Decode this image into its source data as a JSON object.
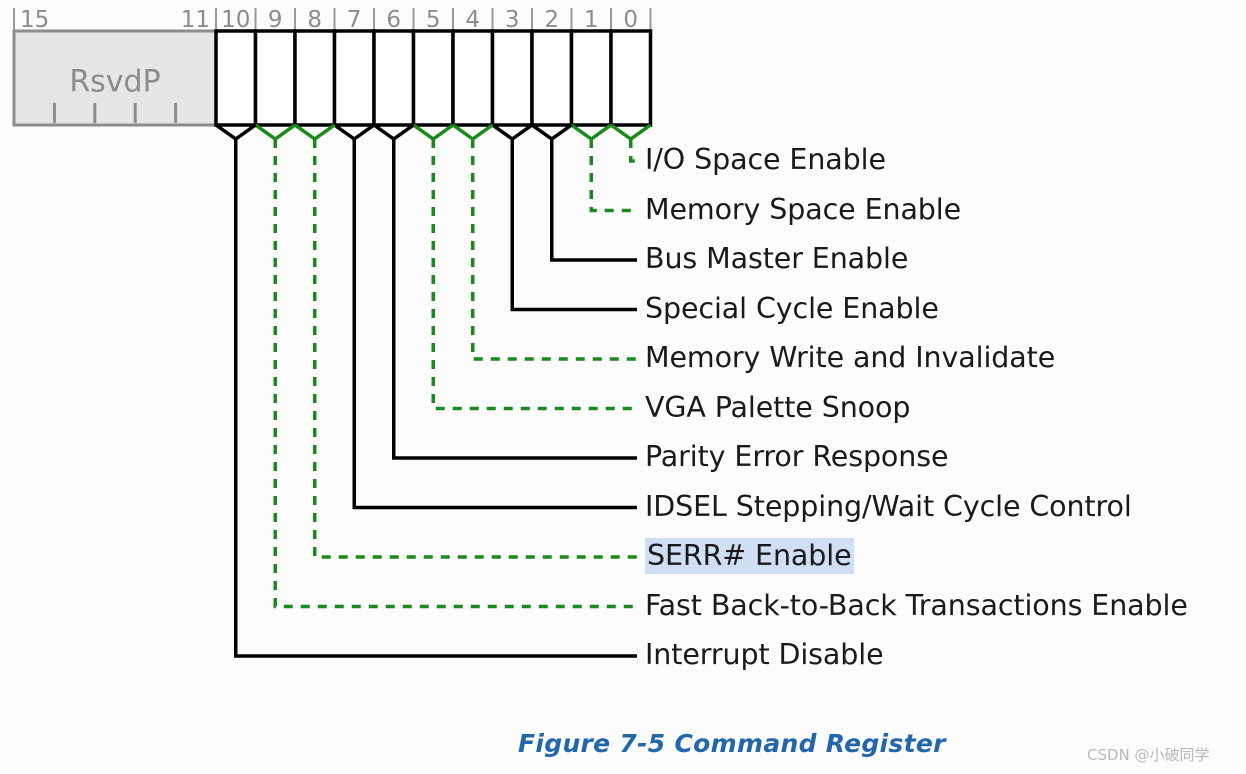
{
  "figure": {
    "caption": "Figure  7-5  Command Register",
    "watermark": "CSDN @小破同学",
    "background_color": "#fcfcfc"
  },
  "colors": {
    "green_leader": "#1a8a1a",
    "black_leader": "#000000",
    "bit_number": "#8c8c8c",
    "reserved_fill": "#e6e6e6",
    "reserved_border": "#8c8c8c",
    "highlight": "#cfe0f5",
    "caption": "#2266ac",
    "watermark": "#b9b9b9"
  },
  "register": {
    "name": "Command Register",
    "width_bits": 16,
    "reserved_field": {
      "label": "RsvdP",
      "bit_high": "15",
      "bit_low": "11",
      "tick_count": 4
    },
    "bit_numbers": [
      "10",
      "9",
      "8",
      "7",
      "6",
      "5",
      "4",
      "3",
      "2",
      "1",
      "0"
    ]
  },
  "bit_labels": [
    {
      "bit": "0",
      "text": "I/O Space Enable",
      "style": "green",
      "highlighted": false
    },
    {
      "bit": "1",
      "text": "Memory Space Enable",
      "style": "green",
      "highlighted": false
    },
    {
      "bit": "2",
      "text": "Bus Master Enable",
      "style": "black",
      "highlighted": false
    },
    {
      "bit": "3",
      "text": "Special Cycle Enable",
      "style": "black",
      "highlighted": false
    },
    {
      "bit": "4",
      "text": "Memory Write and Invalidate",
      "style": "green",
      "highlighted": false
    },
    {
      "bit": "5",
      "text": "VGA Palette Snoop",
      "style": "green",
      "highlighted": false
    },
    {
      "bit": "6",
      "text": "Parity Error Response",
      "style": "black",
      "highlighted": false
    },
    {
      "bit": "7",
      "text": "IDSEL Stepping/Wait Cycle Control",
      "style": "black",
      "highlighted": false
    },
    {
      "bit": "8",
      "text": "SERR# Enable",
      "style": "green",
      "highlighted": true
    },
    {
      "bit": "9",
      "text": "Fast Back-to-Back Transactions Enable",
      "style": "green",
      "highlighted": false
    },
    {
      "bit": "10",
      "text": "Interrupt Disable",
      "style": "black",
      "highlighted": false
    }
  ]
}
